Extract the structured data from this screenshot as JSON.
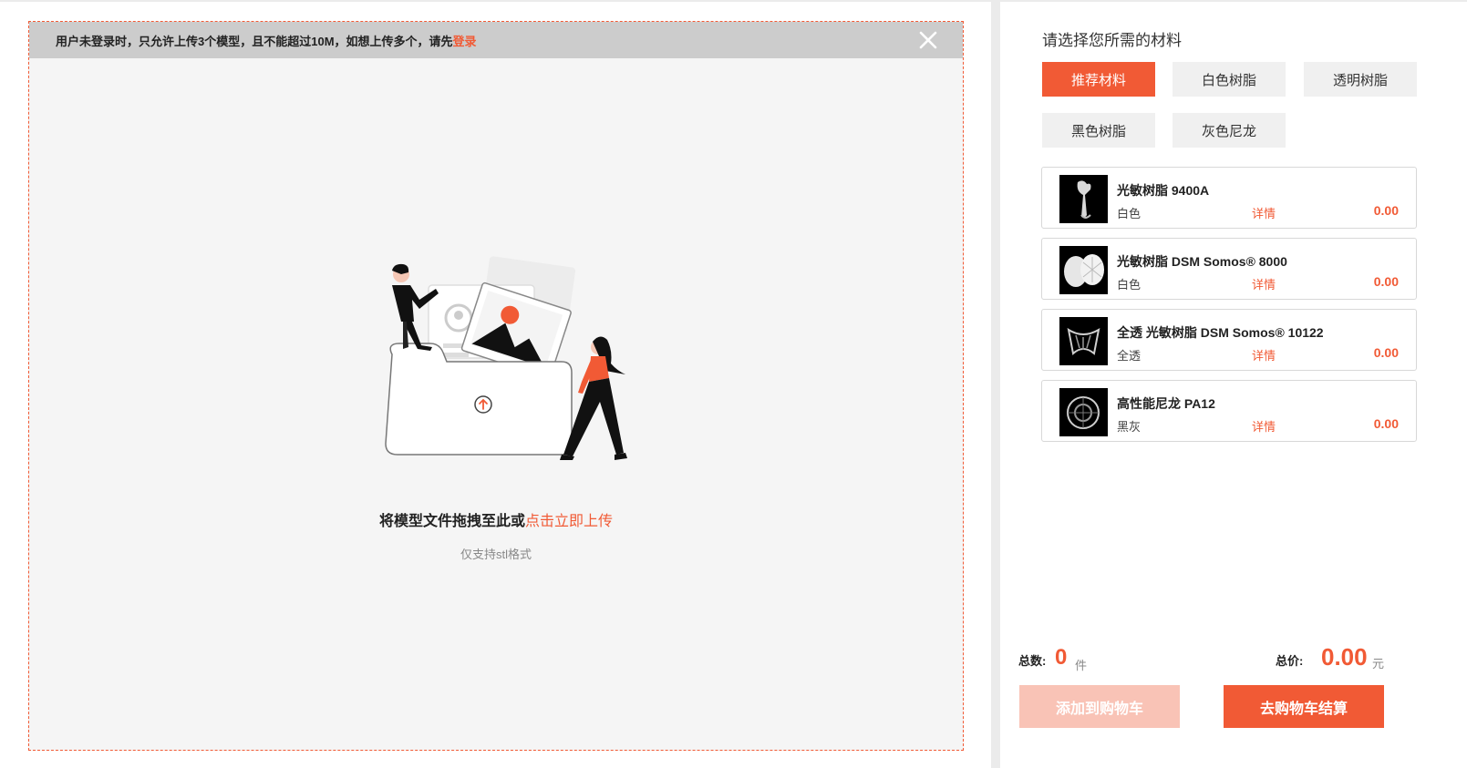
{
  "upload": {
    "notice_text": "用户未登录时，只允许上传3个模型，且不能超过10M，如想上传多个，请先",
    "notice_login": "登录",
    "drop_text": "将模型文件拖拽至此或",
    "drop_link": "点击立即上传",
    "format_hint": "仅支持stl格式"
  },
  "materials": {
    "title": "请选择您所需的材料",
    "categories": [
      {
        "label": "推荐材料",
        "active": true
      },
      {
        "label": "白色树脂",
        "active": false
      },
      {
        "label": "透明树脂",
        "active": false
      },
      {
        "label": "黑色树脂",
        "active": false
      },
      {
        "label": "灰色尼龙",
        "active": false
      }
    ],
    "items": [
      {
        "name": "光敏树脂 9400A",
        "color": "白色",
        "detail": "详情",
        "price": "0.00"
      },
      {
        "name": "光敏树脂 DSM Somos® 8000",
        "color": "白色",
        "detail": "详情",
        "price": "0.00"
      },
      {
        "name": "全透 光敏树脂 DSM Somos® 10122",
        "color": "全透",
        "detail": "详情",
        "price": "0.00"
      },
      {
        "name": "高性能尼龙 PA12",
        "color": "黑灰",
        "detail": "详情",
        "price": "0.00"
      }
    ]
  },
  "summary": {
    "count_label": "总数:",
    "count_value": "0",
    "count_unit": "件",
    "price_label": "总价:",
    "price_value": "0.00",
    "price_unit": "元",
    "add_to_cart": "添加到购物车",
    "checkout": "去购物车结算"
  },
  "colors": {
    "accent": "#f15a35",
    "accent_light": "#f9c3b6"
  }
}
